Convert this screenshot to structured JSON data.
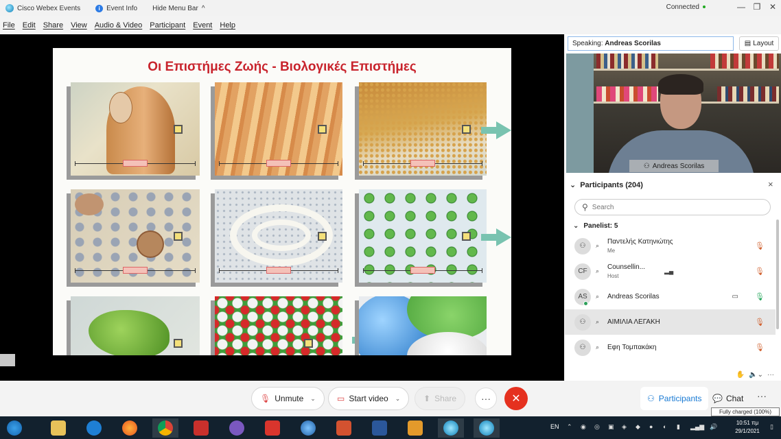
{
  "titlebar": {
    "app_name": "Cisco Webex Events",
    "event_info": "Event Info",
    "hide_menu": "Hide Menu Bar",
    "hide_menu_chevron": "^",
    "status": "Connected"
  },
  "menu": [
    "File",
    "Edit",
    "Share",
    "View",
    "Audio & Video",
    "Participant",
    "Event",
    "Help"
  ],
  "slide": {
    "title": "Οι Επιστήμες Ζωής - Βιολογικές Επιστήμες"
  },
  "stage_panel": {
    "speaking_prefix": "Speaking:",
    "speaking_name": "Andreas Scorilas",
    "layout_label": "Layout",
    "video_name": "Andreas Scorilas"
  },
  "participants": {
    "header": "Participants (204)",
    "search_placeholder": "Search",
    "panelist_header": "Panelist: 5",
    "rows": [
      {
        "avatar": "",
        "name": "Παντελής Κατηνιώτης",
        "role": "Me",
        "mic": "muted",
        "selected": false
      },
      {
        "avatar": "CF",
        "name": "Counsellin...",
        "role": "Host",
        "mic": "muted",
        "selected": false
      },
      {
        "avatar": "AS",
        "name": "Andreas Scorilas",
        "role": "",
        "mic": "active",
        "selected": false
      },
      {
        "avatar": "",
        "name": "ΑΙΜΙΛΙΑ ΛΕΓΑΚΗ",
        "role": "",
        "mic": "muted",
        "selected": true
      },
      {
        "avatar": "",
        "name": "Εφη Τομπακάκη",
        "role": "",
        "mic": "muted",
        "selected": false
      }
    ]
  },
  "controls": {
    "unmute": "Unmute",
    "start_video": "Start video",
    "share": "Share",
    "more": "···",
    "leave": "✕",
    "participants": "Participants",
    "chat": "Chat",
    "overflow": "···"
  },
  "tooltip": "Fully charged (100%)",
  "taskbar": {
    "lang": "EN",
    "time": "10:51 πμ",
    "date": "29/1/2021",
    "apps": [
      "windows",
      "file-explorer",
      "internet-explorer",
      "firefox",
      "chrome",
      "media-player",
      "viber",
      "downloader",
      "google-earth",
      "powerpoint",
      "word",
      "video-player",
      "webex-a",
      "webex-b"
    ]
  },
  "colors": {
    "accent": "#1779d3",
    "leave_red": "#e5311f",
    "slide_title": "#c8232c",
    "arrow_teal": "#79c3b0"
  }
}
